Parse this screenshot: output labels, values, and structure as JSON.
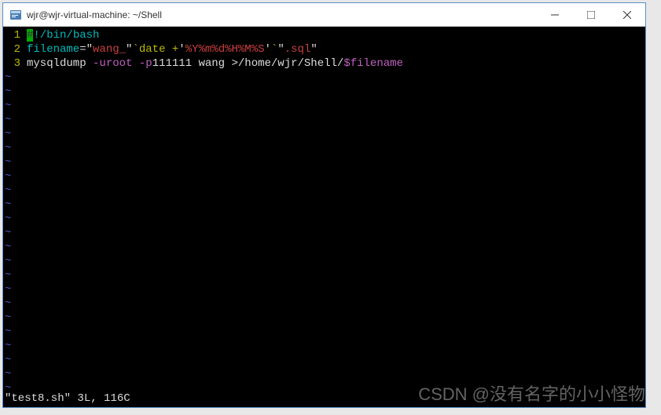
{
  "titlebar": {
    "title": "wjr@wjr-virtual-machine: ~/Shell"
  },
  "code": {
    "line1": {
      "num": "1",
      "shebang_hash": "#",
      "shebang_rest": "!/bin/bash"
    },
    "line2": {
      "num": "2",
      "var": "filename",
      "eq": "=",
      "q1": "\"",
      "str1": "wang_",
      "q2": "\"",
      "bt1": "`",
      "cmd": "date +",
      "q3": "'",
      "fmt": "%Y%m%d%H%M%S",
      "q4": "'",
      "bt2": "`",
      "q5": "\"",
      "str2": ".sql",
      "q6": "\""
    },
    "line3": {
      "num": "3",
      "cmd": "mysqldump",
      "opts": " -uroot -p",
      "pwd": "111111",
      "db": " wang ",
      "redir": ">",
      "path": "/home/wjr/Shell/",
      "var": "$filename"
    }
  },
  "tilde": "~",
  "status": "\"test8.sh\" 3L, 116C",
  "watermark": "CSDN @没有名字的小小怪物"
}
